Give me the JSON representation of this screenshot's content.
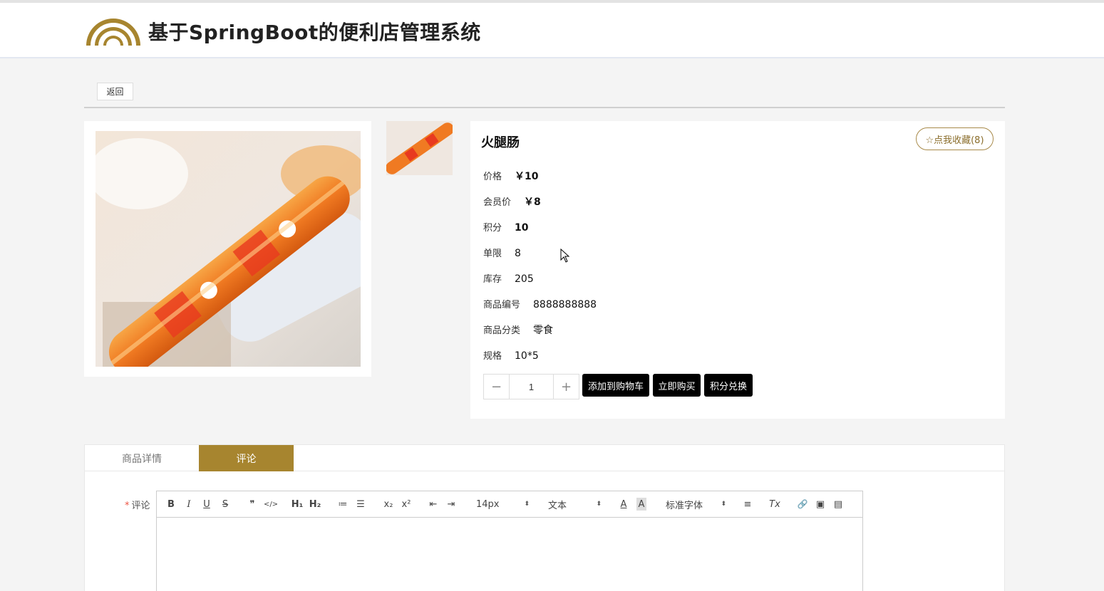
{
  "header": {
    "title": "基于SpringBoot的便利店管理系统"
  },
  "back_label": "返回",
  "product": {
    "name": "火腿肠",
    "favorite_label": "☆点我收藏(8)",
    "fields": [
      {
        "label": "价格",
        "value": "￥10"
      },
      {
        "label": "会员价",
        "value": "￥8"
      },
      {
        "label": "积分",
        "value": "10"
      },
      {
        "label": "单限",
        "value": "8"
      },
      {
        "label": "库存",
        "value": "205"
      },
      {
        "label": "商品编号",
        "value": "8888888888"
      },
      {
        "label": "商品分类",
        "value": "零食"
      },
      {
        "label": "规格",
        "value": "10*5"
      }
    ]
  },
  "quantity": {
    "minus": "−",
    "value": "1",
    "plus": "+"
  },
  "actions": {
    "add_cart": "添加到购物车",
    "buy_now": "立即购买",
    "points_redeem": "积分兑换"
  },
  "tabs": [
    {
      "label": "商品详情",
      "active": false
    },
    {
      "label": "评论",
      "active": true
    }
  ],
  "comment": {
    "required_mark": "*",
    "label": "评论",
    "toolbar": {
      "bold": "B",
      "italic": "I",
      "underline": "U",
      "strike": "S",
      "quote": "❞",
      "code": "</>",
      "h1": "H₁",
      "h2": "H₂",
      "ordered_list": "≔",
      "bullet_list": "☰",
      "subscript": "x₂",
      "superscript": "x²",
      "outdent": "⇤",
      "indent": "⇥",
      "size": "14px",
      "heading": "文本",
      "font": "标准字体",
      "select_arrow": "⬍",
      "color": "A",
      "background": "A",
      "align": "≡",
      "clean": "Tx",
      "link": "🔗",
      "image": "▣",
      "video": "▤"
    }
  },
  "colors": {
    "accent": "#a7852f",
    "button": "#000000"
  }
}
